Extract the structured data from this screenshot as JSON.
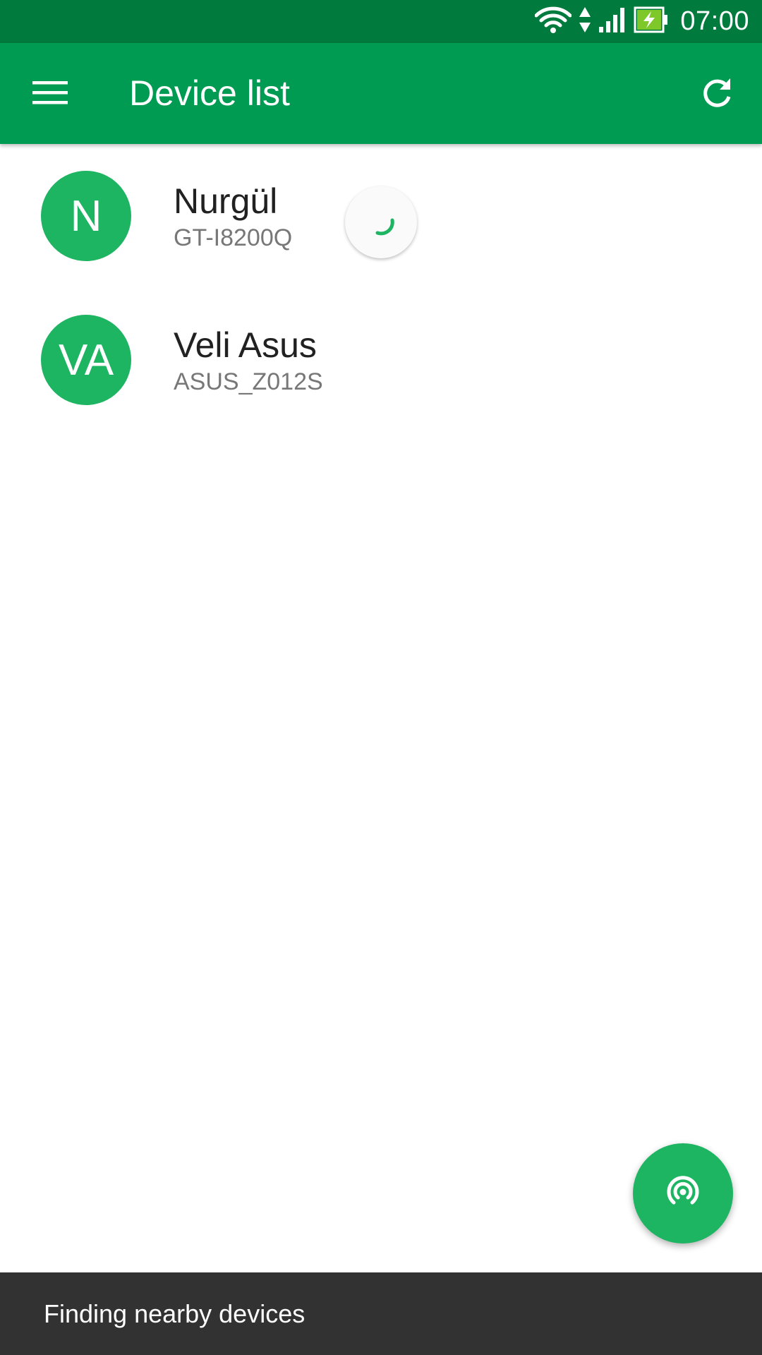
{
  "status_bar": {
    "time": "07:00",
    "icons": [
      "wifi-icon",
      "data-arrows-icon",
      "signal-icon",
      "battery-charging-icon"
    ]
  },
  "app_bar": {
    "title": "Device list",
    "menu_icon": "menu-icon",
    "refresh_icon": "refresh-icon"
  },
  "devices": [
    {
      "initials": "N",
      "name": "Nurgül",
      "model": "GT-I8200Q",
      "loading": true
    },
    {
      "initials": "VA",
      "name": "Veli Asus",
      "model": "ASUS_Z012S",
      "loading": false
    }
  ],
  "fab": {
    "icon": "broadcast-icon"
  },
  "snackbar": {
    "text": "Finding nearby devices"
  },
  "colors": {
    "status_bar": "#007a3d",
    "app_bar": "#009b52",
    "accent": "#1db462",
    "snackbar": "#323232"
  }
}
